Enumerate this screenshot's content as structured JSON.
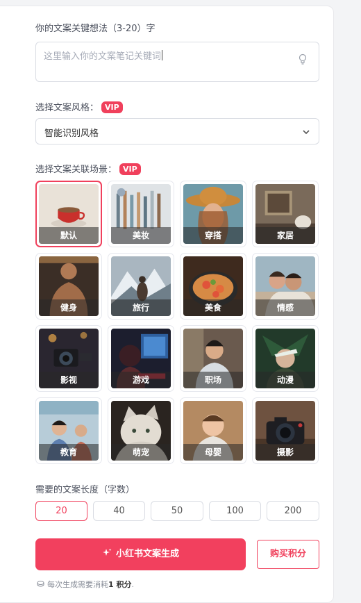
{
  "keyword_section": {
    "label": "你的文案关键想法（3-20）字",
    "placeholder": "这里输入你的文案笔记关键词"
  },
  "style_section": {
    "label": "选择文案风格：",
    "vip": "VIP",
    "selected": "智能识别风格"
  },
  "scene_section": {
    "label": "选择文案关联场景：",
    "vip": "VIP",
    "scenes": [
      "默认",
      "美妆",
      "穿搭",
      "家居",
      "健身",
      "旅行",
      "美食",
      "情感",
      "影视",
      "游戏",
      "职场",
      "动漫",
      "教育",
      "萌宠",
      "母婴",
      "摄影"
    ],
    "selected_index": 0
  },
  "length_section": {
    "label": "需要的文案长度（字数）",
    "options": [
      "20",
      "40",
      "50",
      "100",
      "200"
    ],
    "selected_index": 0
  },
  "actions": {
    "generate": "小红书文案生成",
    "buy": "购买积分"
  },
  "note": {
    "prefix": "每次生成需要消耗",
    "amount": "1 积分",
    "suffix": "."
  },
  "colors": {
    "accent": "#f0405c",
    "border": "#d9dce3"
  },
  "icons": [
    "lightbulb-icon",
    "chevron-down-icon",
    "sparkle-icon",
    "coin-icon"
  ]
}
